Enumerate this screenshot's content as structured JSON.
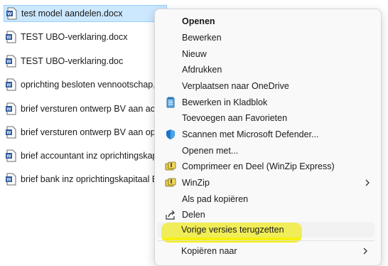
{
  "files": [
    {
      "name": "test model aandelen.docx",
      "selected": true,
      "icon": "word-doc-icon"
    },
    {
      "name": "TEST UBO-verklaring.docx",
      "icon": "word-doc-icon"
    },
    {
      "name": "TEST UBO-verklaring.doc",
      "icon": "word-doc-icon"
    },
    {
      "name": "oprichting besloten vennootschap,",
      "icon": "word-doc-icon"
    },
    {
      "name": "brief versturen ontwerp BV aan acc",
      "icon": "word-doc-icon"
    },
    {
      "name": "brief versturen ontwerp BV aan opri",
      "icon": "word-doc-icon"
    },
    {
      "name": "brief accountant inz oprichtingskap",
      "icon": "word-doc-icon"
    },
    {
      "name": "brief bank inz oprichtingskapitaal B",
      "icon": "word-doc-icon"
    }
  ],
  "context_menu": {
    "items": [
      {
        "label": "Openen",
        "bold": true
      },
      {
        "label": "Bewerken"
      },
      {
        "label": "Nieuw"
      },
      {
        "label": "Afdrukken"
      },
      {
        "label": "Verplaatsen naar OneDrive"
      },
      {
        "label": "Bewerken in Kladblok",
        "icon": "notepad-icon"
      },
      {
        "label": "Toevoegen aan Favorieten"
      },
      {
        "label": "Scannen met Microsoft Defender...",
        "icon": "defender-shield-icon"
      },
      {
        "label": "Openen met..."
      },
      {
        "label": "Comprimeer en Deel (WinZip Express)",
        "icon": "winzip-icon"
      },
      {
        "label": "WinZip",
        "icon": "winzip-icon",
        "submenu": true
      },
      {
        "label": "Als pad kopiëren"
      },
      {
        "label": "Delen",
        "icon": "share-icon"
      },
      {
        "label": "Vorige versies terugzetten",
        "highlighted": true
      },
      {
        "label": "Kopiëren naar",
        "submenu": true
      }
    ]
  },
  "colors": {
    "selection": "#cce8ff",
    "highlight_marker": "#f6f000",
    "word_blue": "#2b579a"
  }
}
